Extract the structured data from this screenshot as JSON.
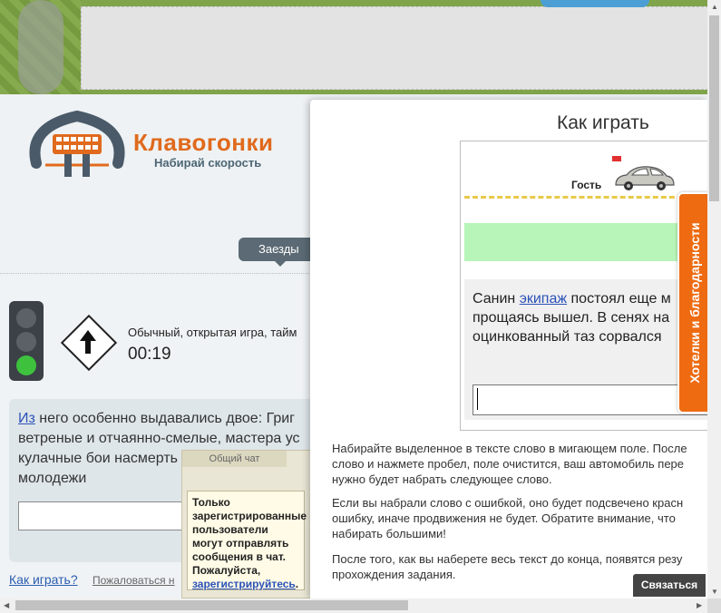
{
  "header": {
    "logo_title": "Клавогонки",
    "logo_subtitle": "Набирай скорость",
    "tab_races": "Заезды"
  },
  "game": {
    "description": "Обычный, открытая игра, тайм",
    "timer": "00:19",
    "race_text_link": "Из",
    "race_text": " него особенно выдавались двое: Григ ветреные и отчаянно-смелые, мастера ус кулачные бои насмерть гвардейской молодежи",
    "link_how_to_play": "Как играть?",
    "link_report": "Пожаловаться н"
  },
  "chat": {
    "tab_label": "Общий чат",
    "message": "Только зарегистрированные пользователи могут отправлять сообщения в чат. Пожалуйста, ",
    "message_link": "зарегистрируйтесь",
    "message_end": "."
  },
  "modal": {
    "title": "Как играть",
    "demo_guest": "Гость",
    "demo_text_before": "Санин ",
    "demo_text_link": "экипаж",
    "demo_text_after": " постоял еще м прощаясь вышел. В сенях на оцинкованный таз сорвался",
    "instructions": [
      "Набирайте выделенное в тексте слово в мигающем поле. После слово и нажмете пробел, поле очистится, ваш автомобиль пере нужно будет набрать следующее слово.",
      "Если вы набрали слово с ошибкой, оно будет подсвечено красн ошибку, иначе продвижения не будет. Обратите внимание, что набирать большими!",
      "После того, как вы наберете весь текст до конца, появятся резу прохождения задания."
    ]
  },
  "side_tab": "Хотелки и благодарности",
  "contact_button": "Связаться",
  "colors": {
    "accent_orange": "#ee6b11",
    "link_blue": "#2b52b8",
    "demo_green": "#b8f5b8"
  }
}
